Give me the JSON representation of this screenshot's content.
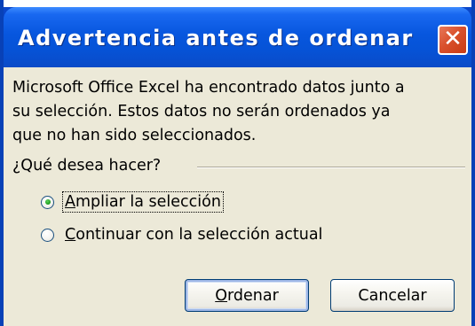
{
  "dialog": {
    "title": "Advertencia antes de ordenar",
    "close_glyph": "✕",
    "message_lines": [
      "Microsoft Office Excel ha encontrado datos junto a",
      "su selección. Estos datos no serán ordenados ya",
      "que no han sido seleccionados."
    ],
    "group_label": "¿Qué desea hacer?",
    "options": [
      {
        "label_hotkey": "A",
        "label_rest": "mpliar la selección",
        "selected": true
      },
      {
        "label_hotkey": "C",
        "label_rest": "ontinuar con la selección actual",
        "selected": false
      }
    ],
    "buttons": {
      "sort": {
        "hotkey": "O",
        "rest": "rdenar"
      },
      "cancel": {
        "label": "Cancelar"
      }
    }
  },
  "colors": {
    "titlebar": "#0653d7",
    "close_button": "#d9502c",
    "client_background": "#ece9d8",
    "radio_dot": "#21a121"
  },
  "icons": {
    "close": "close-icon"
  }
}
